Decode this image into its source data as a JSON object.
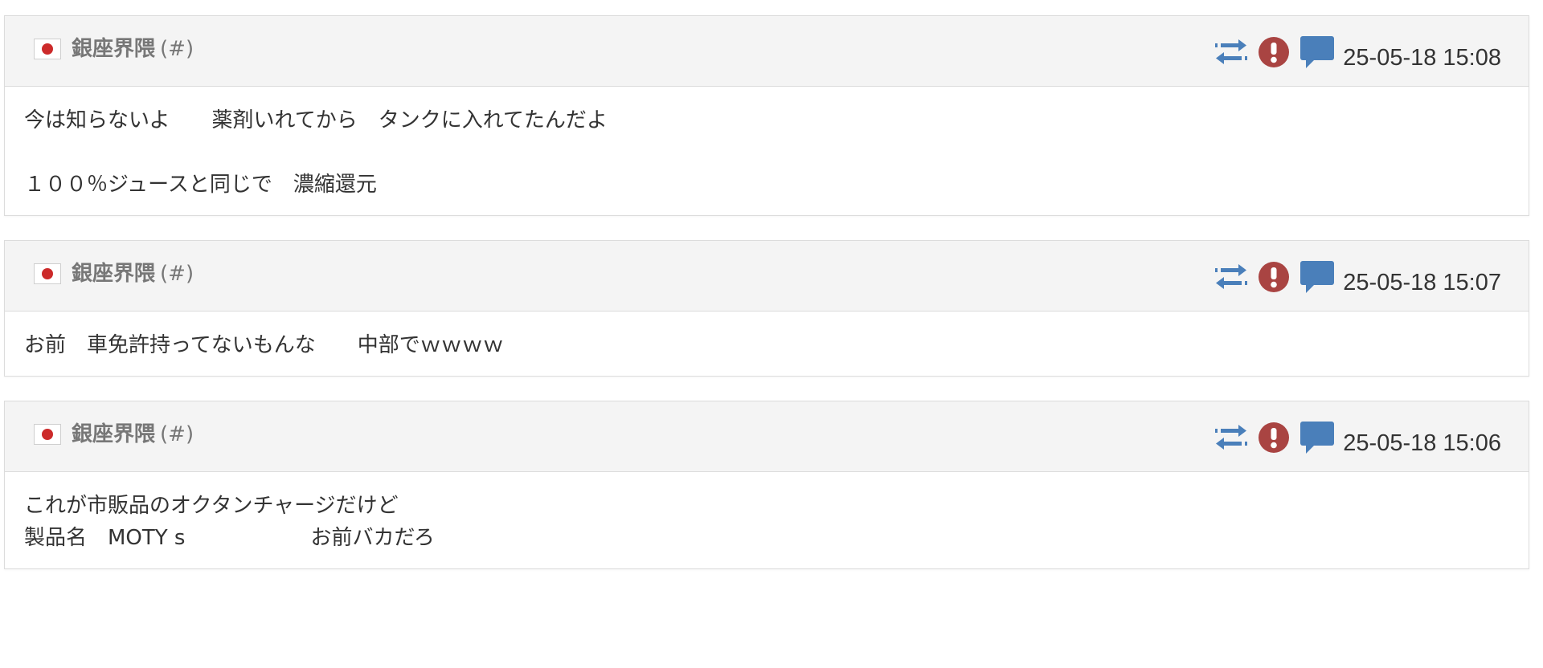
{
  "colors": {
    "header_bg": "#f4f4f4",
    "border": "#dcdcdc",
    "author": "#777777",
    "text": "#333333",
    "retweet_icon": "#4a7fba",
    "report_icon": "#a94442",
    "reply_icon": "#4a7fba",
    "flag_red": "#cc2a2a"
  },
  "posts": [
    {
      "flag_icon": "japan-flag-icon",
      "author": "銀座界隈",
      "hash": "(#)",
      "timestamp": "25-05-18 15:08",
      "lines": [
        "今は知らないよ　　薬剤いれてから　タンクに入れてたんだよ",
        "",
        "１００％ジュースと同じで　濃縮還元"
      ]
    },
    {
      "flag_icon": "japan-flag-icon",
      "author": "銀座界隈",
      "hash": "(#)",
      "timestamp": "25-05-18 15:07",
      "lines": [
        "お前　車免許持ってないもんな　　中部でｗｗｗｗ"
      ]
    },
    {
      "flag_icon": "japan-flag-icon",
      "author": "銀座界隈",
      "hash": "(#)",
      "timestamp": "25-05-18 15:06",
      "lines": [
        "これが市販品のオクタンチャージだけど",
        "製品名　MOTY s　　　　　　お前バカだろ"
      ]
    }
  ]
}
